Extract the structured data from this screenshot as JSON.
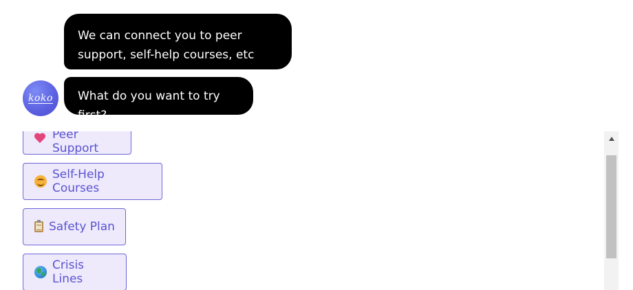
{
  "messages": [
    {
      "line1": "We can connect you to peer",
      "line2": "support, self-help courses, etc"
    },
    {
      "text": "What do you want to try first?"
    }
  ],
  "avatar": {
    "text": "koko",
    "color": "#5a5fe0"
  },
  "options": [
    {
      "label": "Peer Support",
      "icon": "heart-icon"
    },
    {
      "label": "Self-Help Courses",
      "icon": "smiling-face-icon"
    },
    {
      "label": "Safety Plan",
      "icon": "clipboard-icon"
    },
    {
      "label": "Crisis Lines",
      "icon": "globe-icon"
    }
  ],
  "colors": {
    "bubble_bg": "#000000",
    "bubble_text": "#ffffff",
    "option_border": "#6a64d8",
    "option_bg": "#eeeafc",
    "option_text": "#5a52cf"
  }
}
